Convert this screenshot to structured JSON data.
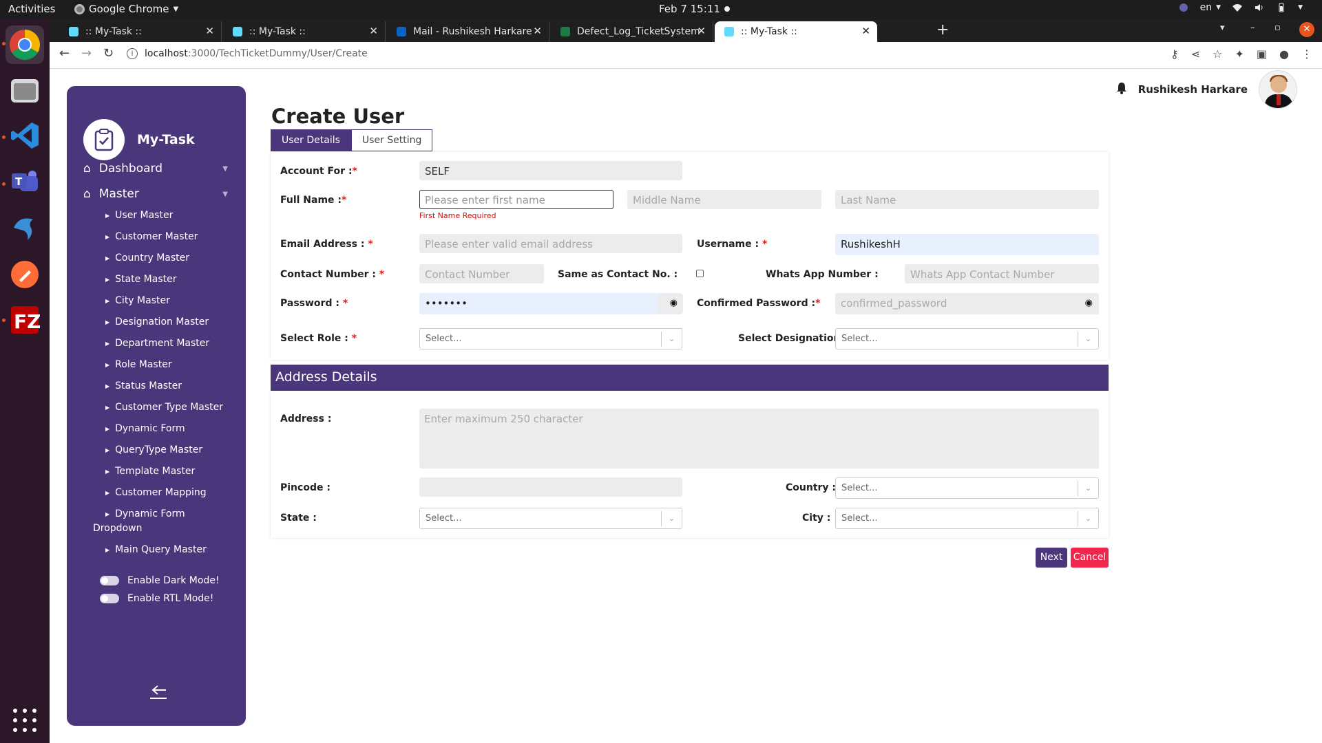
{
  "topbar": {
    "activities": "Activities",
    "app_name": "Google Chrome",
    "clock": "Feb 7  15:11",
    "lang": "en"
  },
  "browser": {
    "tabs": [
      {
        "title": ":: My-Task ::",
        "favicon_color": "#61dafb"
      },
      {
        "title": ":: My-Task ::",
        "favicon_color": "#61dafb"
      },
      {
        "title": "Mail - Rushikesh Harkare -",
        "favicon_color": "#0a64c4"
      },
      {
        "title": "Defect_Log_TicketSystem",
        "favicon_color": "#1d7a45"
      },
      {
        "title": ":: My-Task ::",
        "favicon_color": "#61dafb"
      }
    ],
    "url_host": "localhost",
    "url_path": ":3000/TechTicketDummy/User/Create"
  },
  "sidebar": {
    "brand": "My-Task",
    "top_items": [
      {
        "label": "Dashboard"
      },
      {
        "label": "Master"
      }
    ],
    "sub_items": [
      "User Master",
      "Customer Master",
      "Country Master",
      "State Master",
      "City Master",
      "Designation Master",
      "Department Master",
      "Role Master",
      "Status Master",
      "Customer Type Master",
      "Dynamic Form",
      "QueryType Master",
      "Template Master",
      "Customer Mapping",
      "Dynamic Form",
      "Dropdown",
      "Main Query Master"
    ],
    "dark_mode": "Enable Dark Mode!",
    "rtl_mode": "Enable RTL Mode!"
  },
  "header": {
    "user_name": "Rushikesh Harkare"
  },
  "form": {
    "title": "Create User",
    "tabs": [
      "User Details",
      "User Setting"
    ],
    "account_for_label": "Account For :",
    "account_for_value": "SELF",
    "full_name_label": "Full Name :",
    "first_name_placeholder": "Please enter first name",
    "first_name_error": "First Name Required",
    "middle_name_placeholder": "Middle Name",
    "last_name_placeholder": "Last Name",
    "email_label": "Email Address : ",
    "email_placeholder": "Please enter valid email address",
    "username_label": "Username : ",
    "username_value": "RushikeshH",
    "contact_label": "Contact Number : ",
    "contact_placeholder": "Contact Number",
    "same_as_label": "Same as Contact No. :",
    "whatsapp_label": "Whats App Number :",
    "whatsapp_placeholder": "Whats App Contact Number",
    "password_label": "Password : ",
    "password_value": "•••••••",
    "confirm_label": "Confirmed Password :",
    "confirm_placeholder": "confirmed_password",
    "role_label": "Select Role : ",
    "designation_label": "Select Designation : ",
    "select_placeholder": "Select..."
  },
  "address": {
    "heading": "Address Details",
    "address_label": "Address :",
    "address_placeholder": "Enter maximum 250 character",
    "pincode_label": "Pincode :",
    "country_label": "Country :",
    "state_label": "State :",
    "city_label": "City :",
    "select_placeholder": "Select..."
  },
  "actions": {
    "next": "Next",
    "cancel": "Cancel"
  },
  "colors": {
    "primary": "#4a367a",
    "danger": "#f0264d",
    "error": "#d40b0b"
  }
}
